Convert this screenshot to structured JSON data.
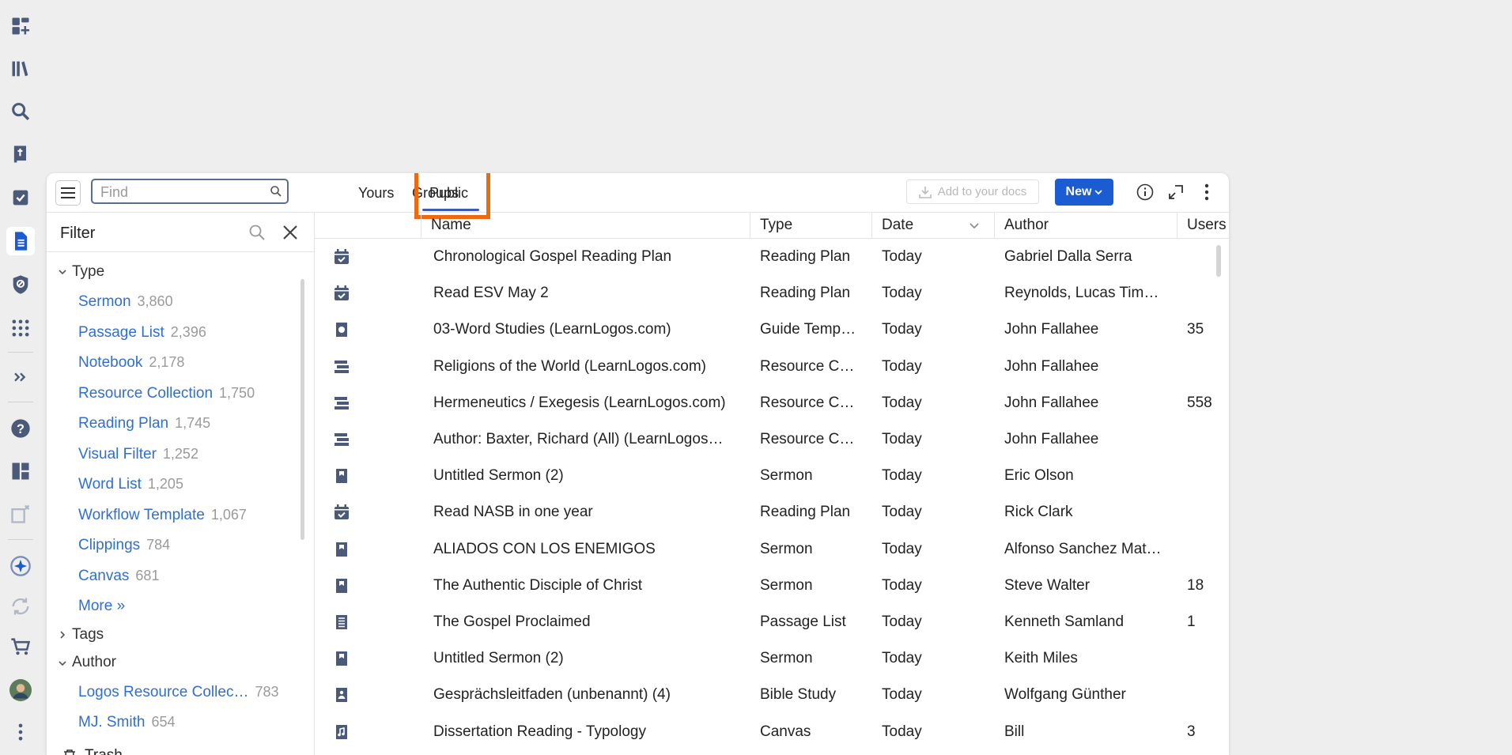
{
  "rail": {
    "icons": [
      "dashboard-add-icon",
      "library-icon",
      "search-icon",
      "bible-icon",
      "checklist-icon",
      "documents-icon",
      "shield-icon",
      "apps-grid-icon",
      "expand-icon",
      "help-icon",
      "layouts-icon",
      "clipboard-icon",
      "ai-sparkle-icon",
      "sync-icon",
      "cart-icon",
      "avatar",
      "more-icon"
    ]
  },
  "toolbar": {
    "find_placeholder": "Find",
    "tabs": [
      "Yours",
      "Groups",
      "Public"
    ],
    "active_tab": "Public",
    "add_to_docs": "Add to your docs",
    "new_button": "New",
    "accent": "#1b5cd3",
    "highlight": "#ee6a10"
  },
  "filter": {
    "title": "Filter",
    "type_section": "Type",
    "type_items": [
      {
        "label": "Sermon",
        "count": "3,860"
      },
      {
        "label": "Passage List",
        "count": "2,396"
      },
      {
        "label": "Notebook",
        "count": "2,178"
      },
      {
        "label": "Resource Collection",
        "count": "1,750"
      },
      {
        "label": "Reading Plan",
        "count": "1,745"
      },
      {
        "label": "Visual Filter",
        "count": "1,252"
      },
      {
        "label": "Word List",
        "count": "1,205"
      },
      {
        "label": "Workflow Template",
        "count": "1,067"
      },
      {
        "label": "Clippings",
        "count": "784"
      },
      {
        "label": "Canvas",
        "count": "681"
      }
    ],
    "more": "More »",
    "tags_section": "Tags",
    "author_section": "Author",
    "author_items": [
      {
        "label": "Logos Resource Collec…",
        "count": "783"
      },
      {
        "label": "MJ. Smith",
        "count": "654"
      }
    ],
    "trash": "Trash"
  },
  "table": {
    "headers": {
      "name": "Name",
      "type": "Type",
      "date": "Date",
      "author": "Author",
      "users": "Users"
    },
    "rows": [
      {
        "icon": "reading-plan-icon",
        "name": "Chronological Gospel Reading Plan",
        "type": "Reading Plan",
        "date": "Today",
        "author": "Gabriel Dalla Serra",
        "users": ""
      },
      {
        "icon": "reading-plan-icon",
        "name": "Read ESV May 2",
        "type": "Reading Plan",
        "date": "Today",
        "author": "Reynolds, Lucas Tim…",
        "users": ""
      },
      {
        "icon": "guide-template-icon",
        "name": "03-Word Studies (LearnLogos.com)",
        "type": "Guide Temp…",
        "date": "Today",
        "author": "John Fallahee",
        "users": "35"
      },
      {
        "icon": "resource-collection-icon",
        "name": "Religions of the World (LearnLogos.com)",
        "type": "Resource C…",
        "date": "Today",
        "author": "John Fallahee",
        "users": ""
      },
      {
        "icon": "resource-collection-icon",
        "name": "Hermeneutics / Exegesis (LearnLogos.com)",
        "type": "Resource C…",
        "date": "Today",
        "author": "John Fallahee",
        "users": "558"
      },
      {
        "icon": "resource-collection-icon",
        "name": "Author: Baxter, Richard (All) (LearnLogos…",
        "type": "Resource C…",
        "date": "Today",
        "author": "John Fallahee",
        "users": ""
      },
      {
        "icon": "sermon-icon",
        "name": "Untitled Sermon (2)",
        "type": "Sermon",
        "date": "Today",
        "author": "Eric Olson",
        "users": ""
      },
      {
        "icon": "reading-plan-icon",
        "name": "Read NASB in one year",
        "type": "Reading Plan",
        "date": "Today",
        "author": "Rick Clark",
        "users": ""
      },
      {
        "icon": "sermon-icon",
        "name": "ALIADOS CON LOS ENEMIGOS",
        "type": "Sermon",
        "date": "Today",
        "author": "Alfonso Sanchez Mat…",
        "users": ""
      },
      {
        "icon": "sermon-icon",
        "name": "The Authentic Disciple of Christ",
        "type": "Sermon",
        "date": "Today",
        "author": "Steve Walter",
        "users": "18"
      },
      {
        "icon": "passage-list-icon",
        "name": "The Gospel Proclaimed",
        "type": "Passage List",
        "date": "Today",
        "author": "Kenneth Samland",
        "users": "1"
      },
      {
        "icon": "sermon-icon",
        "name": "Untitled Sermon (2)",
        "type": "Sermon",
        "date": "Today",
        "author": "Keith Miles",
        "users": ""
      },
      {
        "icon": "bible-study-icon",
        "name": "Gesprächsleitfaden (unbenannt) (4)",
        "type": "Bible Study",
        "date": "Today",
        "author": "Wolfgang Günther",
        "users": ""
      },
      {
        "icon": "canvas-icon",
        "name": "Dissertation Reading - Typology",
        "type": "Canvas",
        "date": "Today",
        "author": "Bill",
        "users": "3"
      }
    ]
  }
}
